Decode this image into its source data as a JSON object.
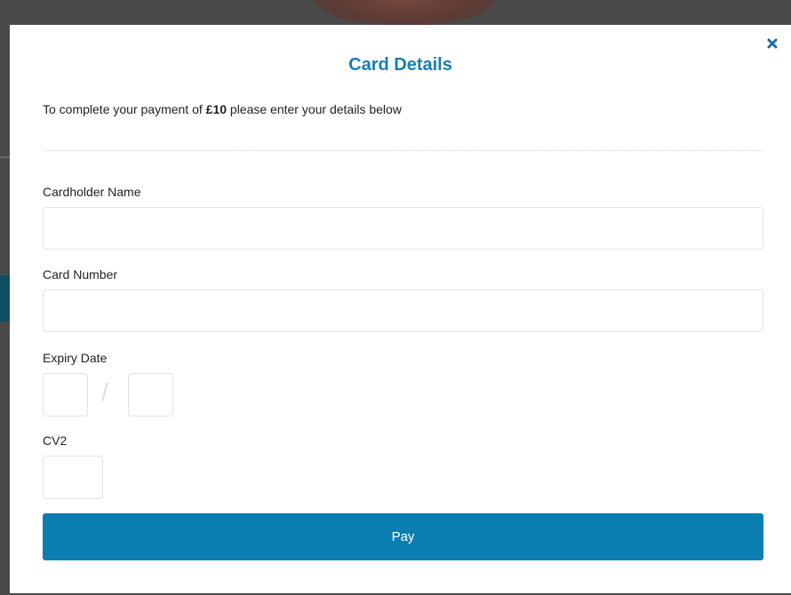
{
  "modal": {
    "title": "Card Details",
    "intro_prefix": "To complete your payment of ",
    "intro_amount": "£10",
    "intro_suffix": " please enter your details below",
    "close_icon": "close-icon"
  },
  "form": {
    "cardholder_label": "Cardholder Name",
    "cardholder_value": "",
    "card_number_label": "Card Number",
    "card_number_value": "",
    "expiry_label": "Expiry Date",
    "expiry_separator": "/",
    "expiry_month_value": "",
    "expiry_year_value": "",
    "cv2_label": "CV2",
    "cv2_value": ""
  },
  "actions": {
    "pay_label": "Pay"
  },
  "colors": {
    "accent": "#1a7fae",
    "button": "#0b7fb1",
    "overlay": "#4a4a4a"
  }
}
